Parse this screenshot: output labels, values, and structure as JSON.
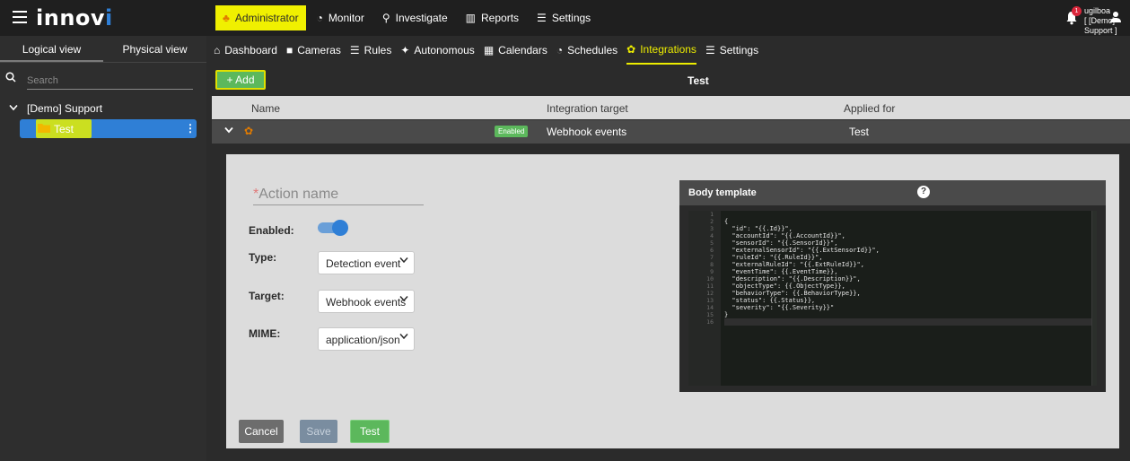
{
  "app": {
    "logo_main": "innov",
    "logo_accent": "i"
  },
  "topnav": [
    {
      "icon": "♣",
      "label": "Administrator"
    },
    {
      "icon": "◔",
      "label": "Monitor"
    },
    {
      "icon": "⚲",
      "label": "Investigate"
    },
    {
      "icon": "▥",
      "label": "Reports"
    },
    {
      "icon": "☰",
      "label": "Settings"
    }
  ],
  "notifications": {
    "count": "1"
  },
  "user": {
    "name": "ugilboa",
    "account": "[ [Demo] Support ]"
  },
  "sidebar": {
    "tabs": [
      "Logical view",
      "Physical view"
    ],
    "search_placeholder": "Search",
    "tree_root": "[Demo] Support",
    "tree_item": "Test"
  },
  "subnav": [
    {
      "icon": "⌂",
      "label": "Dashboard"
    },
    {
      "icon": "■",
      "label": "Cameras"
    },
    {
      "icon": "☰",
      "label": "Rules"
    },
    {
      "icon": "✦",
      "label": "Autonomous"
    },
    {
      "icon": "▦",
      "label": "Calendars"
    },
    {
      "icon": "◔",
      "label": "Schedules"
    },
    {
      "icon": "✿",
      "label": "Integrations"
    },
    {
      "icon": "☰",
      "label": "Settings"
    }
  ],
  "toolbar": {
    "add_label": "+ Add",
    "title": "Test"
  },
  "table": {
    "headers": [
      "Name",
      "Integration target",
      "Applied for"
    ],
    "row": {
      "status": "Enabled",
      "target": "Webhook events",
      "applied_for": "Test"
    }
  },
  "form": {
    "action_name_placeholder": "Action name",
    "enabled_label": "Enabled:",
    "type_label": "Type:",
    "type_value": "Detection event",
    "target_label": "Target:",
    "target_value": "Webhook events",
    "mime_label": "MIME:",
    "mime_value": "application/json",
    "enabled": true
  },
  "buttons": {
    "cancel": "Cancel",
    "save": "Save",
    "test": "Test"
  },
  "body_template": {
    "title": "Body template",
    "help": "?",
    "lines": [
      "",
      "{",
      "  \"id\": \"{{.Id}}\",",
      "  \"accountId\": \"{{.AccountId}}\",",
      "  \"sensorId\": \"{{.SensorId}}\",",
      "  \"externalSensorId\": \"{{.ExtSensorId}}\",",
      "  \"ruleId\": \"{{.RuleId}}\",",
      "  \"externalRuleId\": \"{{.ExtRuleId}}\",",
      "  \"eventTime\": {{.EventTime}},",
      "  \"description\": \"{{.Description}}\",",
      "  \"objectType\": {{.ObjectType}},",
      "  \"behaviorType\": {{.BehaviorType}},",
      "  \"status\": {{.Status}},",
      "  \"severity\": \"{{.Severity}}\"",
      "}",
      ""
    ]
  },
  "colors": {
    "accent_blue": "#2f7fd6",
    "highlight_yellow": "#ecec00",
    "success_green": "#5cb85c",
    "orange": "#e07a00"
  }
}
